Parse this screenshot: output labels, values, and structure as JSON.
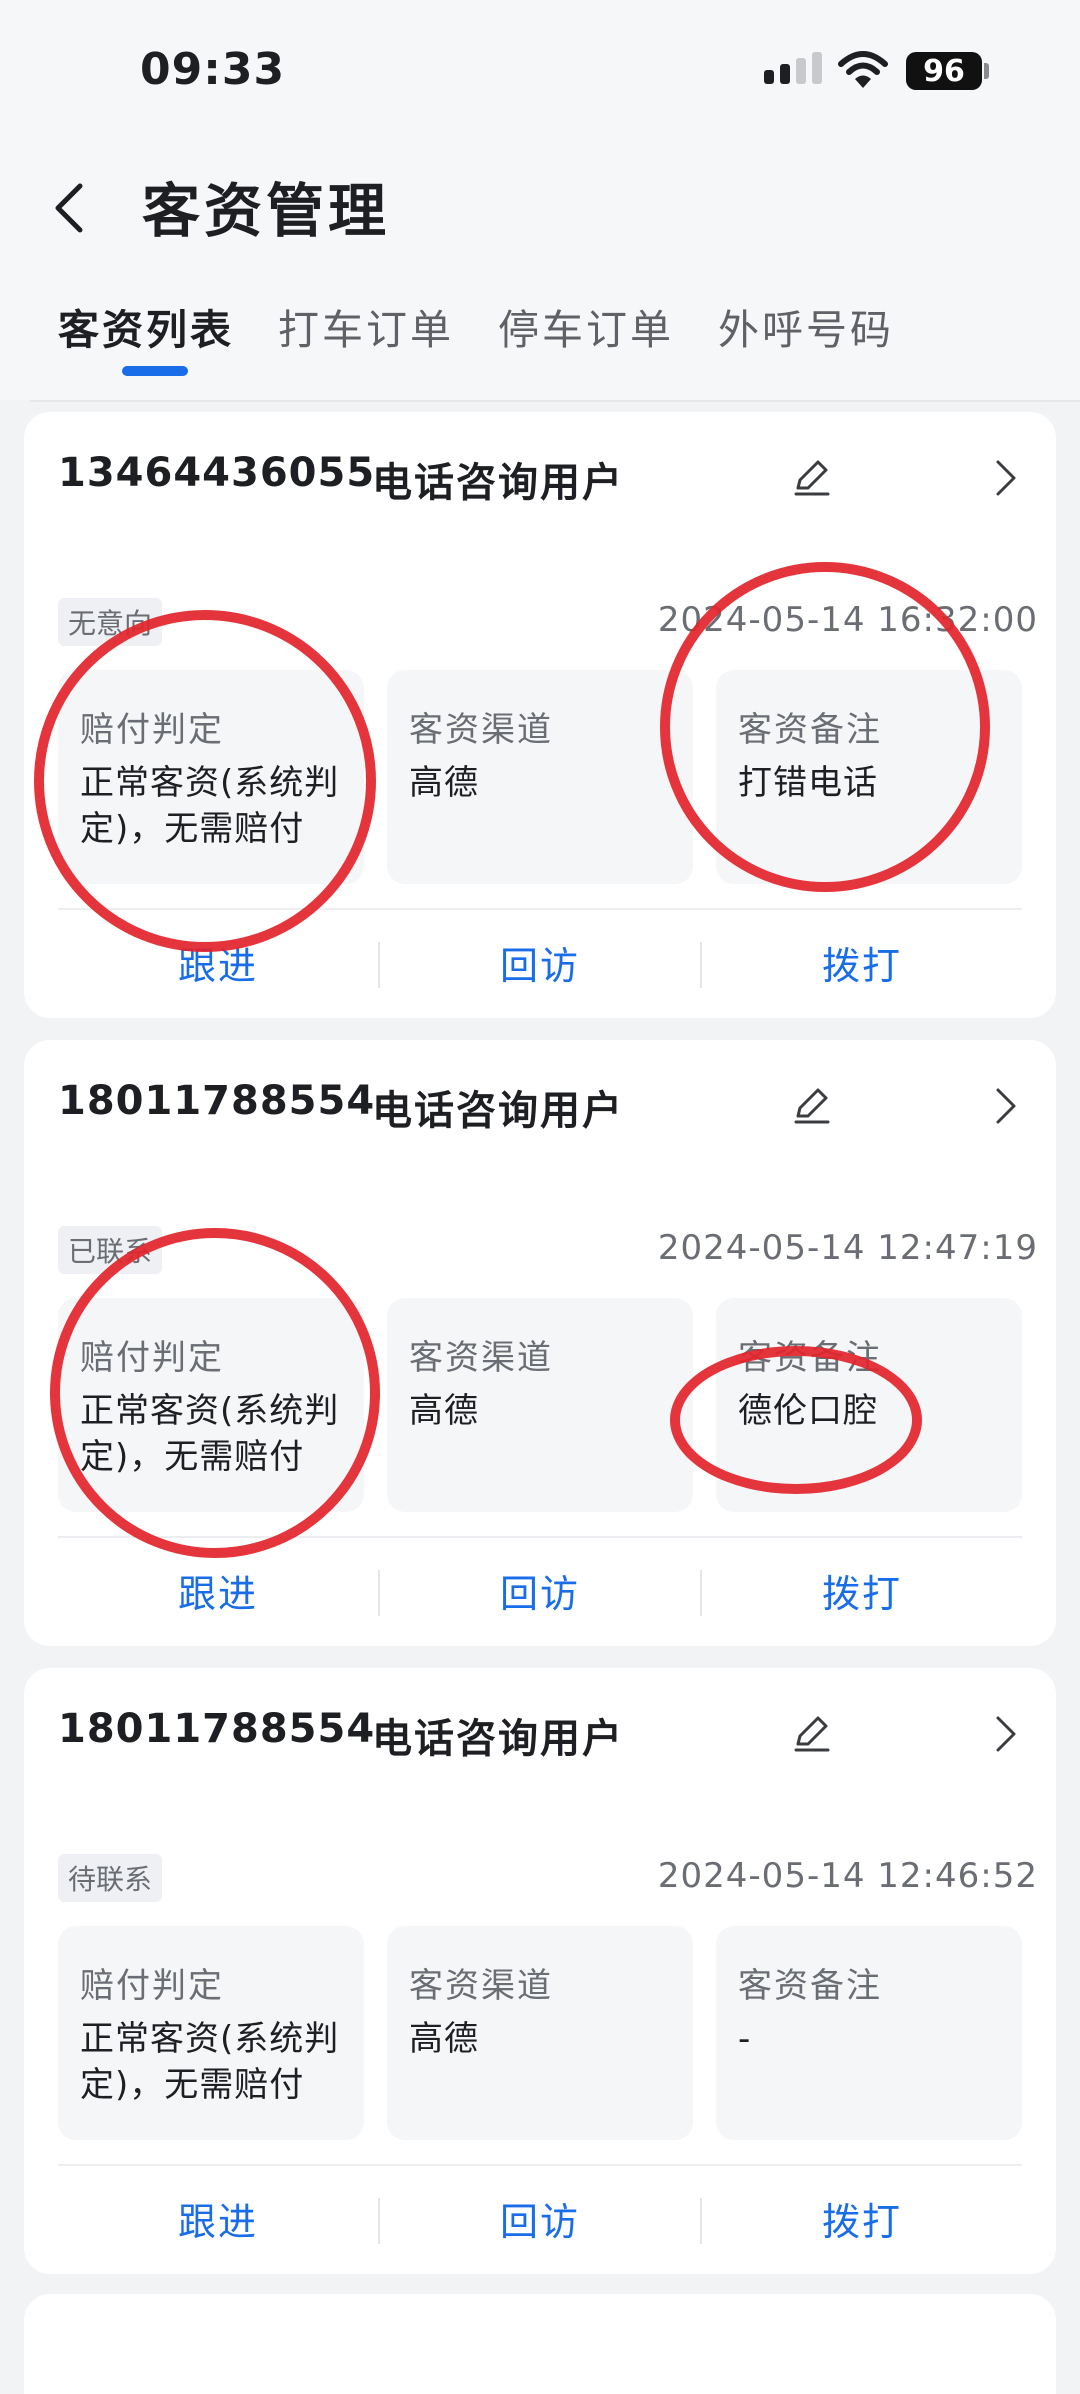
{
  "status_bar": {
    "time": "09:33",
    "battery": "96"
  },
  "header": {
    "title": "客资管理"
  },
  "tabs": [
    {
      "label": "客资列表",
      "active": true
    },
    {
      "label": "打车订单",
      "active": false
    },
    {
      "label": "停车订单",
      "active": false
    },
    {
      "label": "外呼号码",
      "active": false
    }
  ],
  "cards": [
    {
      "phone": "13464436055",
      "user_type": "电话咨询用户",
      "status": "无意向",
      "datetime": "2024-05-14 16:32:00",
      "compensation_label": "赔付判定",
      "compensation_value": "正常客资(系统判定)，无需赔付",
      "channel_label": "客资渠道",
      "channel_value": "高德",
      "note_label": "客资备注",
      "note_value": "打错电话",
      "actions": [
        "跟进",
        "回访",
        "拨打"
      ]
    },
    {
      "phone": "18011788554",
      "user_type": "电话咨询用户",
      "status": "已联系",
      "datetime": "2024-05-14 12:47:19",
      "compensation_label": "赔付判定",
      "compensation_value": "正常客资(系统判定)，无需赔付",
      "channel_label": "客资渠道",
      "channel_value": "高德",
      "note_label": "客资备注",
      "note_value": "德伦口腔",
      "actions": [
        "跟进",
        "回访",
        "拨打"
      ]
    },
    {
      "phone": "18011788554",
      "user_type": "电话咨询用户",
      "status": "待联系",
      "datetime": "2024-05-14 12:46:52",
      "compensation_label": "赔付判定",
      "compensation_value": "正常客资(系统判定)，无需赔付",
      "channel_label": "客资渠道",
      "channel_value": "高德",
      "note_label": "客资备注",
      "note_value": "-",
      "actions": [
        "跟进",
        "回访",
        "拨打"
      ]
    }
  ],
  "colors": {
    "accent": "#1a6de8",
    "annotation": "#e3242b",
    "background": "#f2f3f5"
  },
  "icons": [
    "back-icon",
    "edit-icon",
    "chevron-right-icon",
    "wifi-icon",
    "signal-icon",
    "battery-icon"
  ]
}
